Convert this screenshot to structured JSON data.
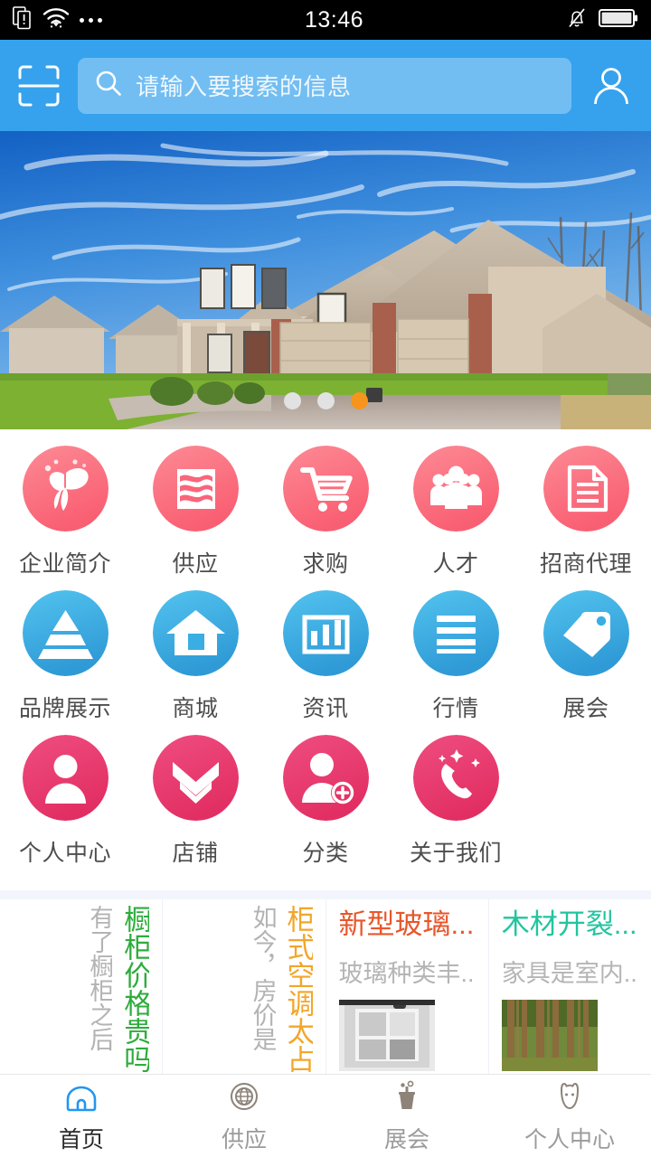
{
  "status_bar": {
    "time": "13:46",
    "left_icons": [
      "sim-alert-icon",
      "wifi-icon",
      "more-dots-icon"
    ],
    "right_icons": [
      "mute-bell-icon",
      "battery-icon"
    ]
  },
  "header": {
    "scan_icon": "scan-qr-icon",
    "search_placeholder": "请输入要搜索的信息",
    "search_value": "",
    "search_icon": "search-icon",
    "user_icon": "user-avatar-icon",
    "bg_color": "#36a2ed"
  },
  "banner": {
    "alt": "suburban house with driveway",
    "dots_total": 3,
    "active_dot": 3,
    "active_color": "#f7941e",
    "inactive_color": "#e2e2e2"
  },
  "grid": {
    "items": [
      {
        "label": "企业简介",
        "icon": "butterfly-icon",
        "theme": "pink"
      },
      {
        "label": "供应",
        "icon": "supply-flag-icon",
        "theme": "pink"
      },
      {
        "label": "求购",
        "icon": "shopping-cart-icon",
        "theme": "pink"
      },
      {
        "label": "人才",
        "icon": "people-group-icon",
        "theme": "pink"
      },
      {
        "label": "招商代理",
        "icon": "document-icon",
        "theme": "pink"
      },
      {
        "label": "品牌展示",
        "icon": "pyramid-icon",
        "theme": "blue"
      },
      {
        "label": "商城",
        "icon": "home-store-icon",
        "theme": "blue"
      },
      {
        "label": "资讯",
        "icon": "bar-chart-icon",
        "theme": "blue"
      },
      {
        "label": "行情",
        "icon": "list-lines-icon",
        "theme": "blue"
      },
      {
        "label": "展会",
        "icon": "tag-icon",
        "theme": "blue"
      },
      {
        "label": "个人中心",
        "icon": "person-icon",
        "theme": "rose"
      },
      {
        "label": "店铺",
        "icon": "double-chevron-down-icon",
        "theme": "rose"
      },
      {
        "label": "分类",
        "icon": "person-add-icon",
        "theme": "rose"
      },
      {
        "label": "关于我们",
        "icon": "phone-sparkle-icon",
        "theme": "rose"
      }
    ],
    "theme_colors": {
      "pink": "#fa7086",
      "blue": "#3bb0e5",
      "rose": "#ea3f72"
    }
  },
  "news": {
    "cards": [
      {
        "layout": "vertical",
        "title": "橱柜价格贵吗",
        "title_color": "#2eac3c",
        "desc": "有了橱柜之后",
        "thumb": null
      },
      {
        "layout": "vertical",
        "title": "柜式空调太占",
        "title_color": "#f2a62a",
        "desc": "如今，房价是",
        "thumb": null
      },
      {
        "layout": "horizontal",
        "title": "新型玻璃...",
        "title_color": "#e8562a",
        "desc": "玻璃种类丰...",
        "thumb": "window-photo-thumb"
      },
      {
        "layout": "horizontal",
        "title": "木材开裂...",
        "title_color": "#23c4a0",
        "desc": "家具是室内...",
        "thumb": "forest-photo-thumb"
      }
    ]
  },
  "tabbar": {
    "tabs": [
      {
        "label": "首页",
        "icon": "home-icon",
        "active": true
      },
      {
        "label": "供应",
        "icon": "globe-icon",
        "active": false
      },
      {
        "label": "展会",
        "icon": "podium-icon",
        "active": false
      },
      {
        "label": "个人中心",
        "icon": "cat-face-icon",
        "active": false
      }
    ],
    "active_color": "#2b2b2b",
    "inactive_color": "#9b9b9b",
    "active_icon_color": "#2196f3"
  }
}
